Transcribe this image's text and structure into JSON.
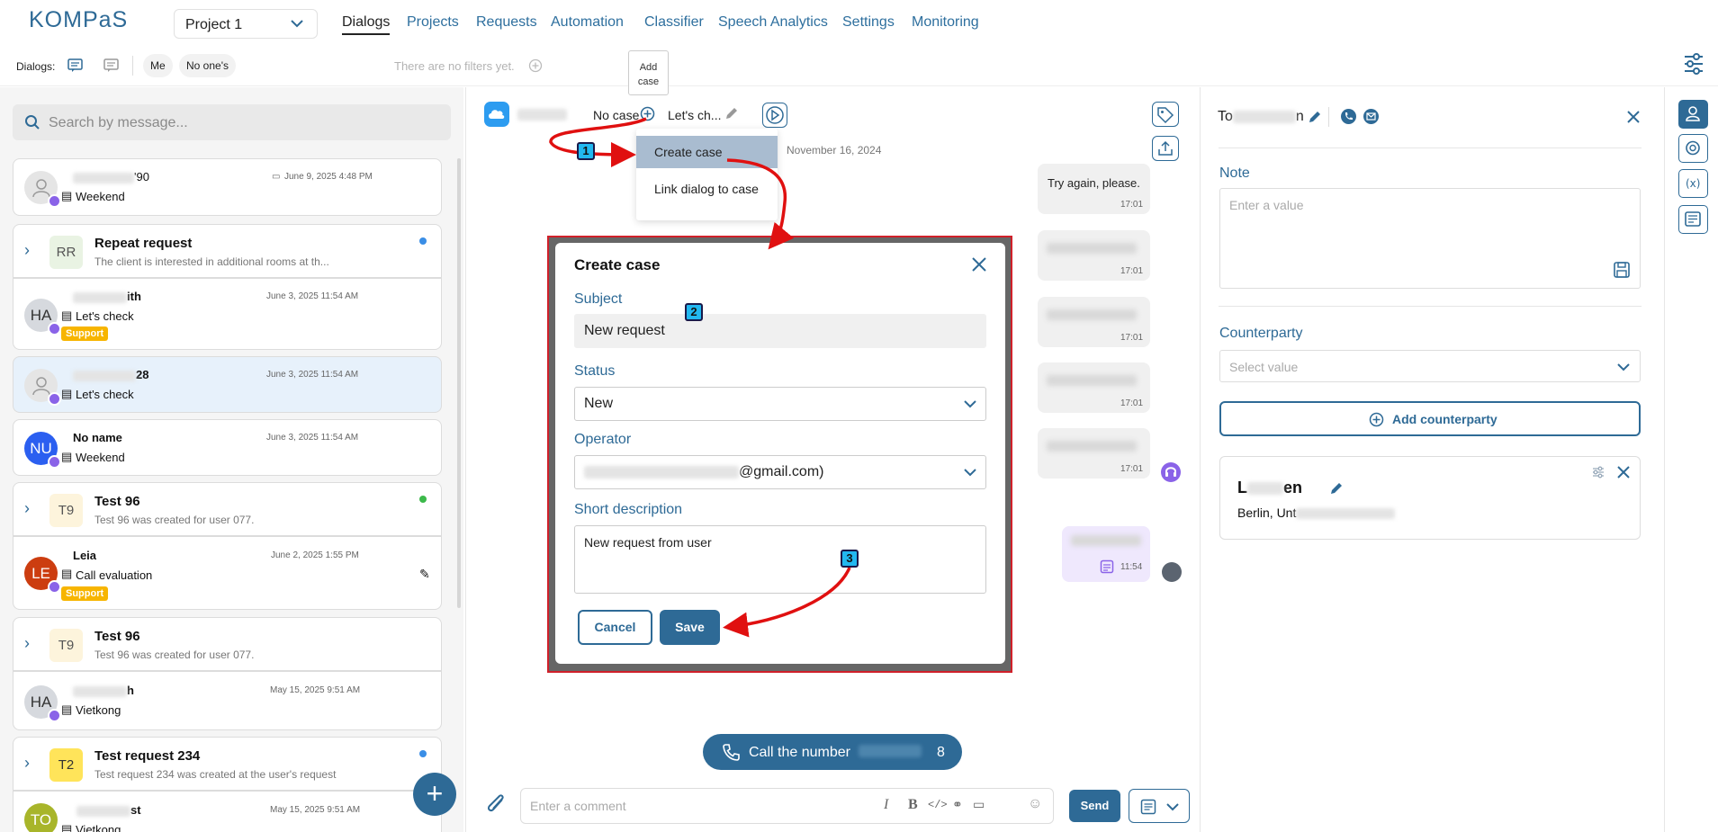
{
  "app": {
    "logo": "KOMPaS",
    "project": "Project 1"
  },
  "nav": [
    "Dialogs",
    "Projects",
    "Requests",
    "Automation",
    "Classifier",
    "Speech Analytics",
    "Settings",
    "Monitoring"
  ],
  "filters": {
    "label": "Dialogs:",
    "me": "Me",
    "no_ones": "No one's",
    "empty": "There are no filters yet."
  },
  "tooltip": {
    "line1": "Add",
    "line2": "case"
  },
  "search": {
    "placeholder": "Search by message..."
  },
  "dialogs": [
    {
      "name": "'90",
      "sub": "Weekend",
      "date": "June 9, 2025 4:48 PM"
    },
    {
      "initials": "RR",
      "title": "Repeat request",
      "desc": "The client is interested in additional rooms at th..."
    },
    {
      "initials": "HA",
      "name": "ith",
      "sub": "Let's check",
      "date": "June 3, 2025 11:54 AM",
      "tag": "Support"
    },
    {
      "name": "28",
      "sub": "Let's check",
      "date": "June 3, 2025 11:54 AM"
    },
    {
      "initials": "NU",
      "name": "No name",
      "sub": "Weekend",
      "date": "June 3, 2025 11:54 AM"
    },
    {
      "initials": "T9",
      "title": "Test 96",
      "desc": "Test 96 was created for user 077."
    },
    {
      "initials": "LE",
      "name": "Leia",
      "sub": "Call evaluation",
      "date": "June 2, 2025 1:55 PM",
      "tag": "Support"
    },
    {
      "initials": "T9",
      "title": "Test 96",
      "desc": "Test 96 was created for user 077."
    },
    {
      "initials": "HA",
      "name": "h",
      "sub": "Vietkong",
      "date": "May 15, 2025 9:51 AM"
    },
    {
      "initials": "T2",
      "title": "Test request 234",
      "desc": "Test request 234 was created at the user's request"
    },
    {
      "initials": "TO",
      "name": "st",
      "sub": "Vietkong",
      "date": "May 15, 2025 9:51 AM"
    }
  ],
  "chat": {
    "no_case": "No case",
    "case_name": "Let's ch...",
    "date_sep": "November 16, 2024",
    "msg1": "Try again, please.",
    "times": [
      "17:01",
      "17:01",
      "17:01",
      "17:01",
      "17:01",
      "11:54"
    ],
    "call_label": "Call the number",
    "call_suffix": "8",
    "comment_placeholder": "Enter a comment",
    "send": "Send"
  },
  "menu": {
    "create": "Create case",
    "link": "Link dialog to case"
  },
  "modal": {
    "title": "Create case",
    "subject_label": "Subject",
    "subject": "New request",
    "status_label": "Status",
    "status": "New",
    "operator_label": "Operator",
    "operator_suffix": "@gmail.com)",
    "desc_label": "Short description",
    "desc": "New request from user",
    "cancel": "Cancel",
    "save": "Save"
  },
  "right": {
    "name_a": "To",
    "name_b": "n",
    "note_label": "Note",
    "note_placeholder": "Enter a value",
    "cp_label": "Counterparty",
    "cp_placeholder": "Select value",
    "add_cp": "Add counterparty",
    "cp_name_a": "L",
    "cp_name_b": "en",
    "cp_addr": "Berlin, Unt"
  },
  "markers": [
    "1",
    "2",
    "3"
  ],
  "colors": {
    "accent": "#2e6a96",
    "highlight": "#d0202a",
    "marker": "#22b8f0"
  }
}
